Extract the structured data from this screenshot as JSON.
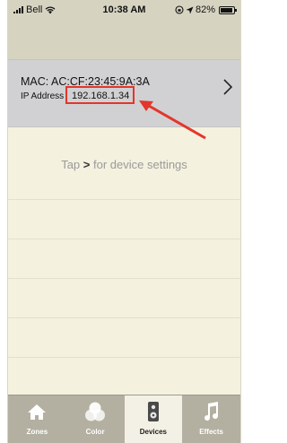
{
  "status_bar": {
    "carrier": "Bell",
    "time": "10:38 AM",
    "battery": "82%"
  },
  "device": {
    "mac": "MAC: AC:CF:23:45:9A:3A",
    "ip_label": "IP Address",
    "ip_value": "192.168.1.34"
  },
  "hint": {
    "prefix": "Tap",
    "symbol": ">",
    "suffix": "for device settings"
  },
  "tabs": [
    {
      "label": "Zones",
      "icon": "home-icon"
    },
    {
      "label": "Color",
      "icon": "color-circles-icon"
    },
    {
      "label": "Devices",
      "icon": "speaker-device-icon",
      "active": true
    },
    {
      "label": "Effects",
      "icon": "music-note-icon"
    }
  ],
  "colors": {
    "highlight": "#e3362c",
    "background": "#f4f1df",
    "tab_bar": "#b3b0a1"
  }
}
